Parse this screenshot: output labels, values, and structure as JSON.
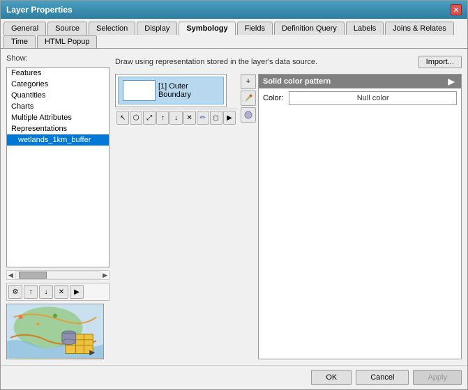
{
  "window": {
    "title": "Layer Properties",
    "close_label": "✕"
  },
  "tabs": [
    {
      "label": "General",
      "active": false
    },
    {
      "label": "Source",
      "active": false
    },
    {
      "label": "Selection",
      "active": false
    },
    {
      "label": "Display",
      "active": false
    },
    {
      "label": "Symbology",
      "active": true
    },
    {
      "label": "Fields",
      "active": false
    },
    {
      "label": "Definition Query",
      "active": false
    },
    {
      "label": "Labels",
      "active": false
    },
    {
      "label": "Joins & Relates",
      "active": false
    },
    {
      "label": "Time",
      "active": false
    },
    {
      "label": "HTML Popup",
      "active": false
    }
  ],
  "left_panel": {
    "show_label": "Show:",
    "items": [
      {
        "label": "Features",
        "selected": false,
        "sub": false
      },
      {
        "label": "Categories",
        "selected": false,
        "sub": false
      },
      {
        "label": "Quantities",
        "selected": false,
        "sub": false
      },
      {
        "label": "Charts",
        "selected": false,
        "sub": false
      },
      {
        "label": "Multiple Attributes",
        "selected": false,
        "sub": false
      },
      {
        "label": "Representations",
        "selected": false,
        "sub": false
      },
      {
        "label": "wetlands_1km_buffer",
        "selected": true,
        "sub": true
      }
    ]
  },
  "right_panel": {
    "info_text": "Draw using representation stored in the layer's data source.",
    "import_label": "Import...",
    "symbol_items": [
      {
        "label": "[1] Outer Boundary",
        "selected": true
      }
    ],
    "solid_color": {
      "header": "Solid color pattern",
      "color_label": "Color:",
      "color_value": "Null color"
    }
  },
  "toolbar": {
    "up_arrow": "↑",
    "down_arrow": "↓",
    "remove": "✕",
    "add": "+",
    "right_arrow": "▶"
  },
  "footer": {
    "ok_label": "OK",
    "cancel_label": "Cancel",
    "apply_label": "Apply"
  },
  "icons": {
    "gear": "⚙",
    "up": "↑",
    "down": "↓",
    "x": "✕",
    "right": "▶",
    "plus": "+",
    "pencil": "✏",
    "cylinder": "⬤",
    "paint": "🎨",
    "pointer": "↖",
    "lasso": "⬡",
    "move": "⤢"
  }
}
